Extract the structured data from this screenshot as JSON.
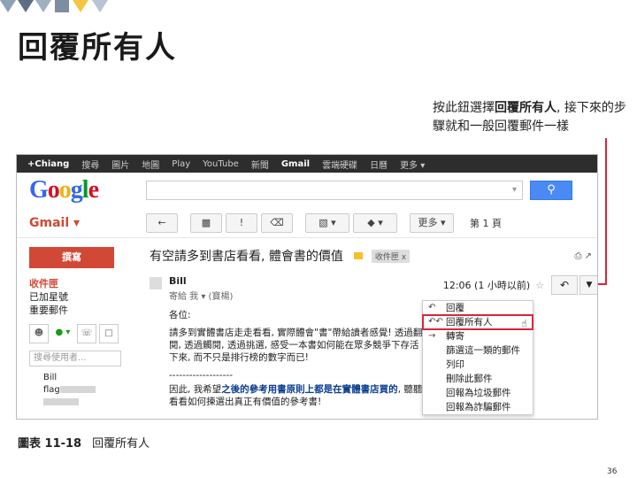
{
  "slide": {
    "title": "回覆所有人",
    "callout_pre": "按此鈕選擇",
    "callout_bold": "回覆所有人",
    "callout_post": ", 接下來的步驟就和一般回覆郵件一樣",
    "caption_num": "圖表 11-18",
    "caption_text": "回覆所有人",
    "page_number": "36"
  },
  "google_bar": {
    "items": [
      "+Chiang",
      "搜尋",
      "圖片",
      "地圖",
      "Play",
      "YouTube",
      "新聞",
      "Gmail",
      "雲端硬碟",
      "日曆",
      "更多 ▾"
    ]
  },
  "search": {
    "logo": "Google"
  },
  "toolbar": {
    "gmail_label": "Gmail ▾",
    "more_label": "更多 ▾",
    "page_indicator": "第 1 頁"
  },
  "left_nav": {
    "compose": "撰寫",
    "items": [
      "收件匣",
      "已加星號",
      "重要郵件"
    ],
    "chat_search_placeholder": "搜尋使用者...",
    "contacts": [
      "Bill",
      "flag"
    ]
  },
  "email": {
    "subject": "有空請多到書店看看, 體會書的價值",
    "label": "收件匣 x",
    "sender": "Bill",
    "to_line": "寄給 我 ▾  (寶楊)",
    "time": "12:06 (1 小時以前)",
    "greeting": "各位:",
    "para1": "請多到實體書店走走看看, 實際體會\"書\"帶給讀者感覺! 透過翻閱, 透過觸閱, 透過挑選, 感受一本書如何能在眾多競爭下存活下來, 而不只是排行榜的數字而已!",
    "divider": "-------------------",
    "para2_pre": "因此, 我希望",
    "para2_hl": "之後的參考用書原則上都是在實體書店買的",
    "para2_post": ", 聽聽看看如何揀選出真正有價值的參考書!"
  },
  "dropdown": {
    "items": [
      {
        "icon": "reply-icon",
        "label": "回覆"
      },
      {
        "icon": "reply-all-icon",
        "label": "回覆所有人"
      },
      {
        "icon": "forward-icon",
        "label": "轉寄"
      },
      {
        "icon": "",
        "label": "篩選這一類的郵件"
      },
      {
        "icon": "",
        "label": "列印"
      },
      {
        "icon": "",
        "label": "刪除此郵件"
      },
      {
        "icon": "",
        "label": "回報為垃圾郵件"
      },
      {
        "icon": "",
        "label": "回報為詐騙郵件"
      }
    ]
  },
  "colors": {
    "accent_red": "#d9263a",
    "gmail_red": "#d14836",
    "search_blue": "#4a8af4"
  }
}
